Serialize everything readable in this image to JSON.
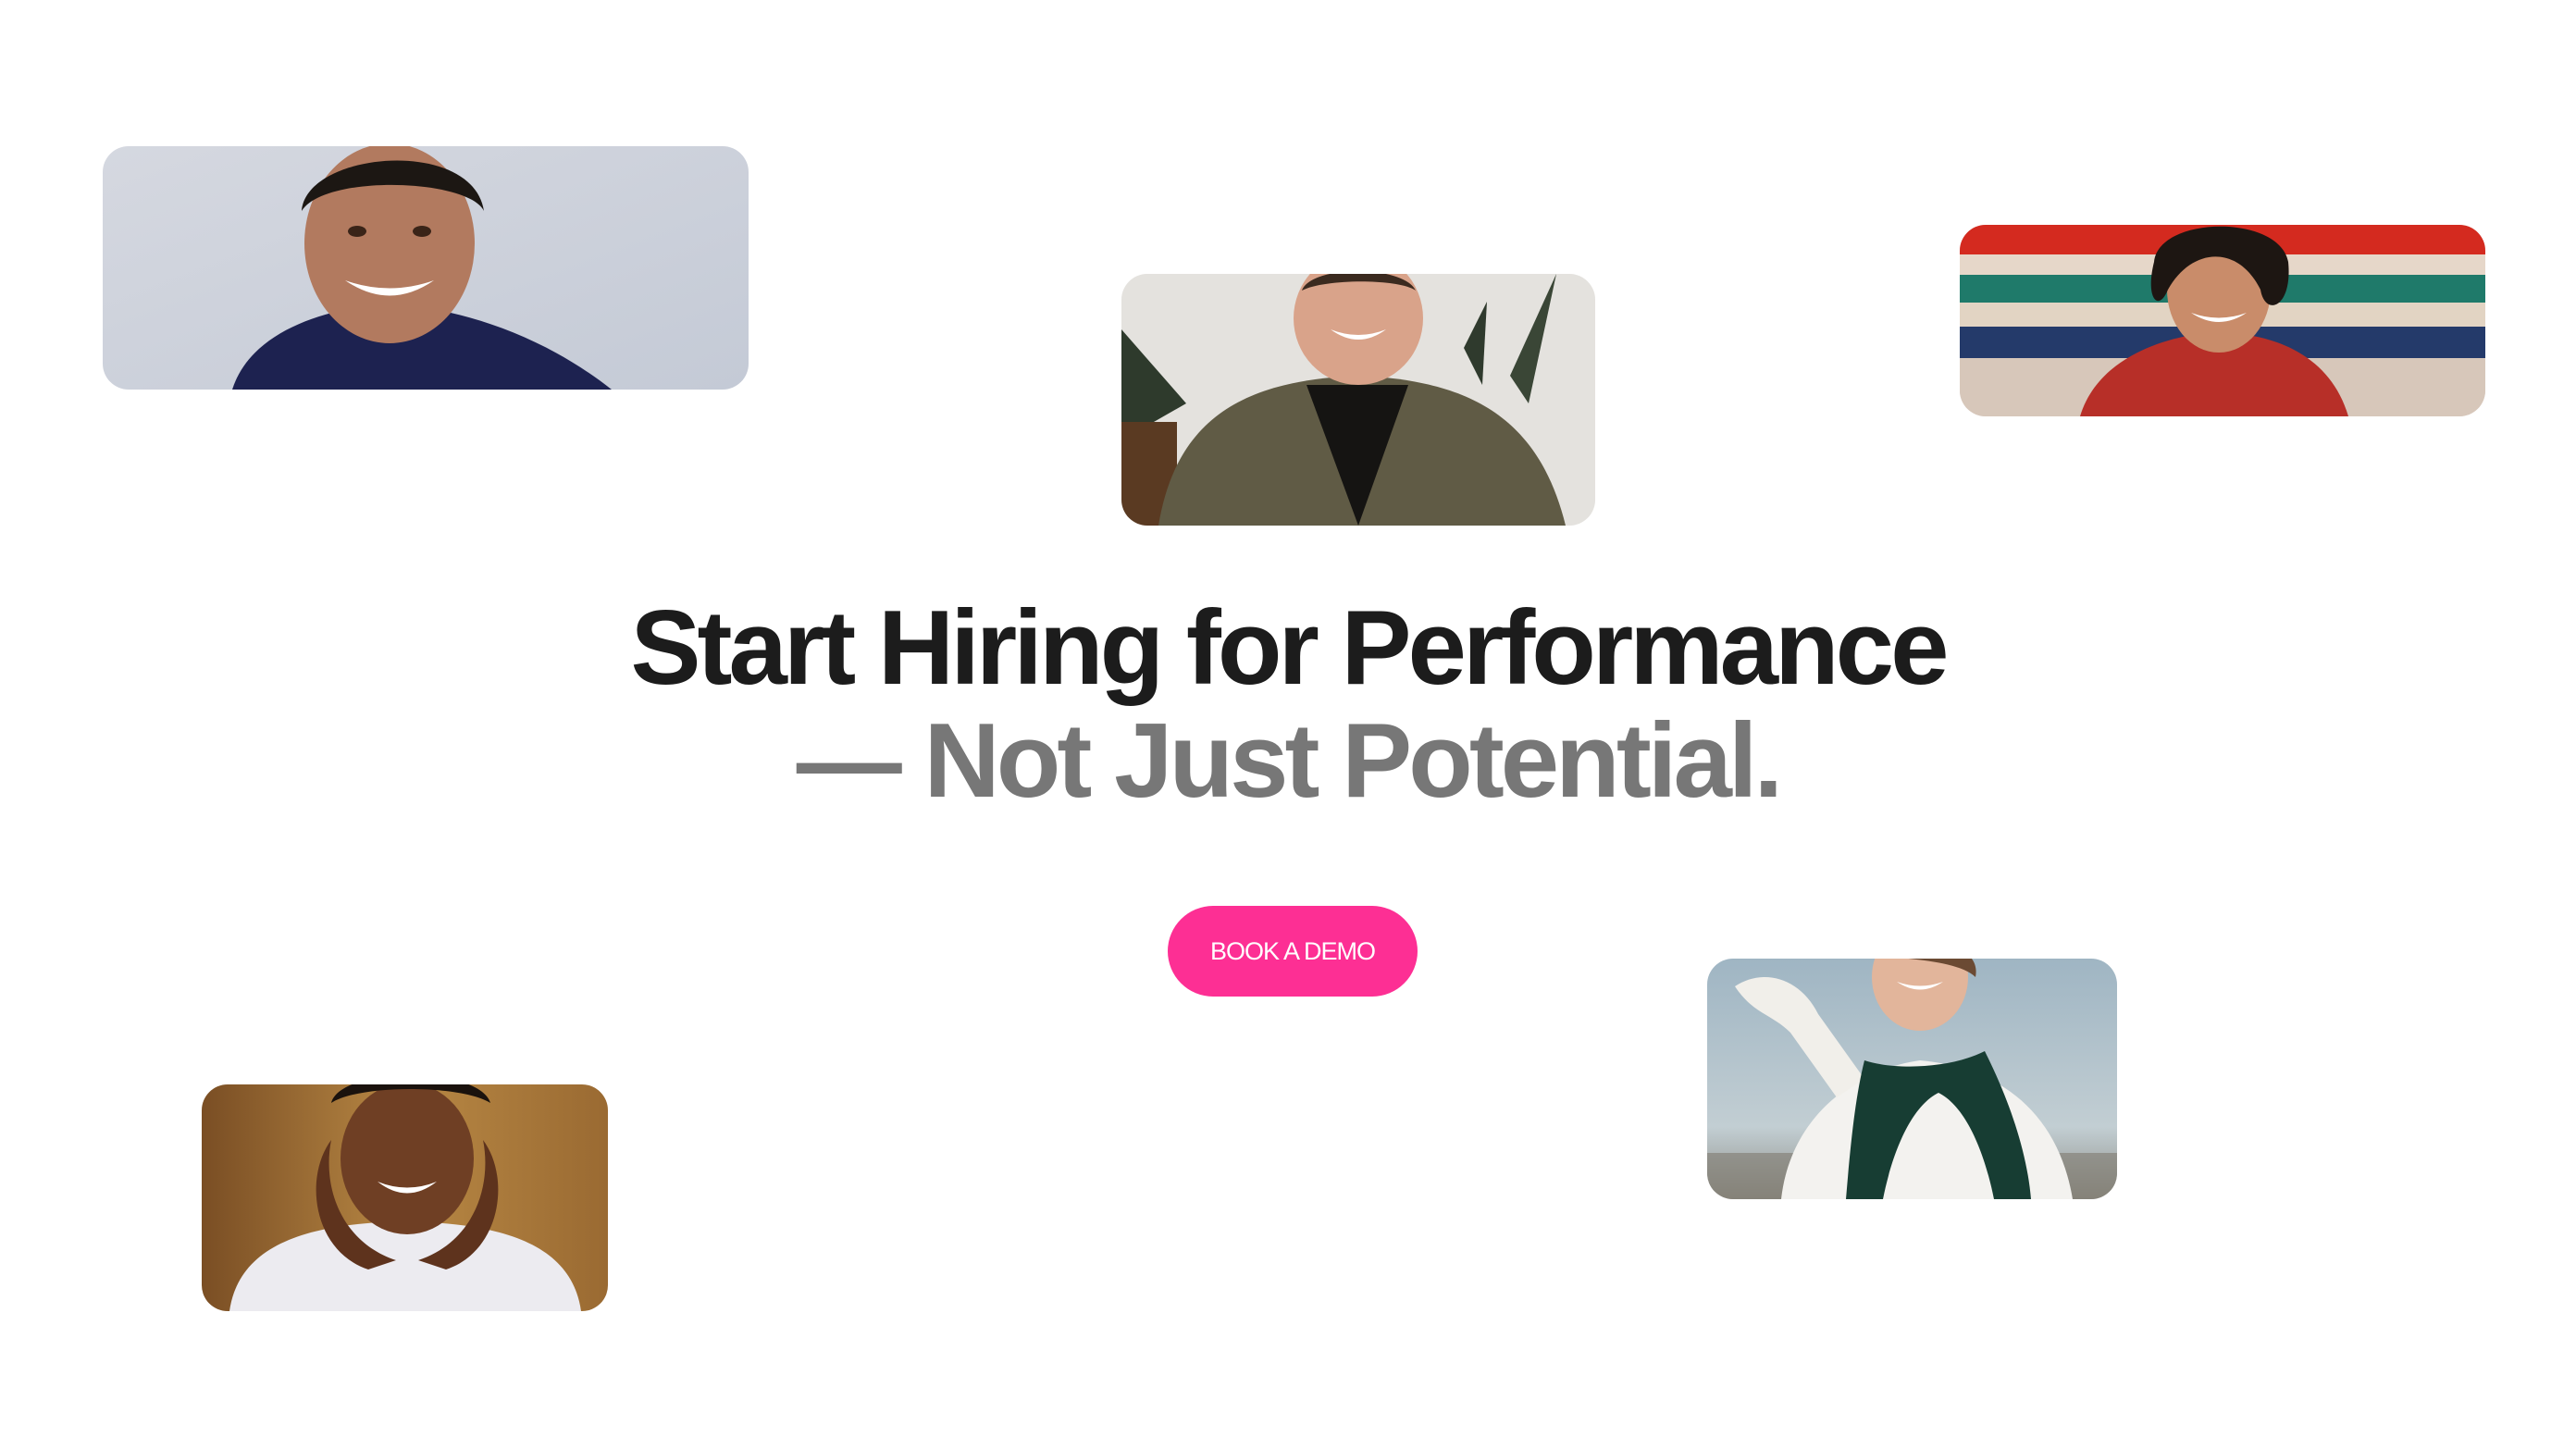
{
  "hero": {
    "headline_line1": "Start Hiring for Performance",
    "headline_line2": "— Not Just Potential.",
    "cta_label": "BOOK A DEMO"
  },
  "colors": {
    "background": "#ffffff",
    "headline_primary": "#1c1c1c",
    "headline_secondary": "#777777",
    "cta_background": "#fd2f94",
    "cta_text": "#ffffff"
  },
  "photos": [
    {
      "name": "photo-smiling-man-navy-sweater",
      "backdrop": "#ccd1dc"
    },
    {
      "name": "photo-man-olive-jacket",
      "backdrop": "#e9e7e4"
    },
    {
      "name": "photo-woman-red-shirt-striped-wall",
      "backdrop": "#cdbdb0"
    },
    {
      "name": "photo-woman-white-shirt-green-sweater",
      "backdrop": "#a9bcc6"
    },
    {
      "name": "photo-woman-hands-on-cheeks",
      "backdrop": "#9c6a33"
    }
  ]
}
